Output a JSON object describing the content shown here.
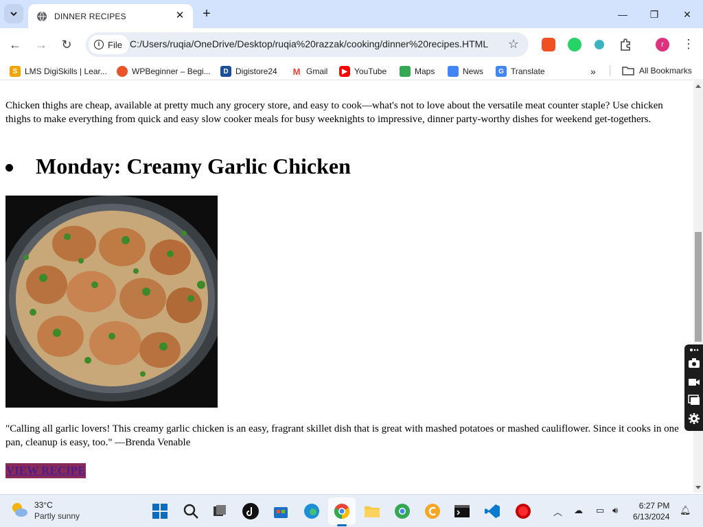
{
  "browser": {
    "tab_title": "DINNER RECIPES",
    "url_chip": "File",
    "url": "C:/Users/ruqia/OneDrive/Desktop/ruqia%20razzak/cooking/dinner%20recipes.HTML",
    "profile_initial": "r"
  },
  "bookmarks": [
    {
      "label": "LMS DigiSkills | Lear...",
      "icon": "digiskills-icon",
      "color": "#f0a500"
    },
    {
      "label": "WPBeginner – Begi...",
      "icon": "wpbeginner-icon",
      "color": "#e8542a"
    },
    {
      "label": "Digistore24",
      "icon": "digistore-icon",
      "color": "#1b4f9c"
    },
    {
      "label": "Gmail",
      "icon": "gmail-icon",
      "color": "#ea4335"
    },
    {
      "label": "YouTube",
      "icon": "youtube-icon",
      "color": "#ff0000"
    },
    {
      "label": "Maps",
      "icon": "maps-icon",
      "color": "#34a853"
    },
    {
      "label": "News",
      "icon": "news-icon",
      "color": "#4285f4"
    },
    {
      "label": "Translate",
      "icon": "translate-icon",
      "color": "#4285f4"
    }
  ],
  "all_bookmarks_label": "All Bookmarks",
  "content": {
    "intro": "Chicken thighs are cheap, available at pretty much any grocery store, and easy to cook—what's not to love about the versatile meat counter staple? Use chicken thighs to make everything from quick and easy slow cooker meals for busy weeknights to impressive, dinner party-worthy dishes for weekend get-togethers.",
    "heading": "Monday: Creamy Garlic Chicken",
    "quote": "\"Calling all garlic lovers! This creamy garlic chicken is an easy, fragrant skillet dish that is great with mashed potatoes or mashed cauliflower. Since it cooks in one pan, cleanup is easy, too.\" —Brenda Venable",
    "link": "VIEW RECIPE"
  },
  "taskbar": {
    "temperature": "33°C",
    "condition": "Partly sunny",
    "time": "6:27 PM",
    "date": "6/13/2024"
  }
}
